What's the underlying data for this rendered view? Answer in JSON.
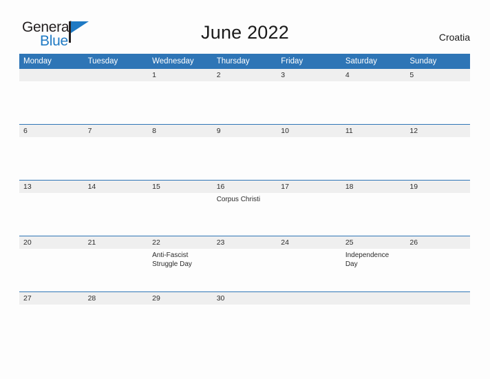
{
  "brand": {
    "name_part1": "General",
    "name_part2": "Blue",
    "accent_color": "#1f7ac4"
  },
  "header": {
    "title": "June 2022",
    "country": "Croatia"
  },
  "calendar": {
    "header_bg": "#2e75b6",
    "daynum_bg": "#efefef",
    "weekday_headers": [
      "Monday",
      "Tuesday",
      "Wednesday",
      "Thursday",
      "Friday",
      "Saturday",
      "Sunday"
    ],
    "weeks": [
      [
        {
          "day": "",
          "events": []
        },
        {
          "day": "",
          "events": []
        },
        {
          "day": "1",
          "events": []
        },
        {
          "day": "2",
          "events": []
        },
        {
          "day": "3",
          "events": []
        },
        {
          "day": "4",
          "events": []
        },
        {
          "day": "5",
          "events": []
        }
      ],
      [
        {
          "day": "6",
          "events": []
        },
        {
          "day": "7",
          "events": []
        },
        {
          "day": "8",
          "events": []
        },
        {
          "day": "9",
          "events": []
        },
        {
          "day": "10",
          "events": []
        },
        {
          "day": "11",
          "events": []
        },
        {
          "day": "12",
          "events": []
        }
      ],
      [
        {
          "day": "13",
          "events": []
        },
        {
          "day": "14",
          "events": []
        },
        {
          "day": "15",
          "events": []
        },
        {
          "day": "16",
          "events": [
            "Corpus Christi"
          ]
        },
        {
          "day": "17",
          "events": []
        },
        {
          "day": "18",
          "events": []
        },
        {
          "day": "19",
          "events": []
        }
      ],
      [
        {
          "day": "20",
          "events": []
        },
        {
          "day": "21",
          "events": []
        },
        {
          "day": "22",
          "events": [
            "Anti-Fascist",
            "Struggle Day"
          ]
        },
        {
          "day": "23",
          "events": []
        },
        {
          "day": "24",
          "events": []
        },
        {
          "day": "25",
          "events": [
            "Independence Day"
          ]
        },
        {
          "day": "26",
          "events": []
        }
      ],
      [
        {
          "day": "27",
          "events": []
        },
        {
          "day": "28",
          "events": []
        },
        {
          "day": "29",
          "events": []
        },
        {
          "day": "30",
          "events": []
        },
        {
          "day": "",
          "events": []
        },
        {
          "day": "",
          "events": []
        },
        {
          "day": "",
          "events": []
        }
      ]
    ]
  }
}
